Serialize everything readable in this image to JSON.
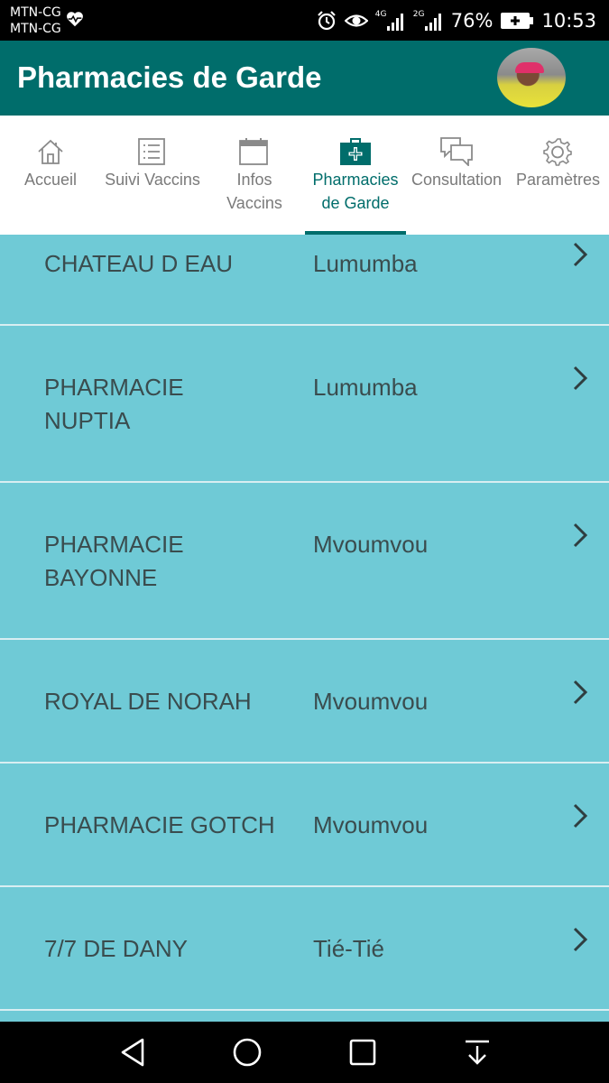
{
  "status_bar": {
    "carrier_1": "MTN-CG",
    "carrier_2": "MTN-CG",
    "network_1": "4G",
    "network_2": "2G",
    "battery": "76%",
    "time": "10:53"
  },
  "app_bar": {
    "title": "Pharmacies de Garde",
    "accent": "#006d6b"
  },
  "tabs": [
    {
      "label_1": "Accueil",
      "label_2": "",
      "icon": "home-icon"
    },
    {
      "label_1": "Suivi Vaccins",
      "label_2": "",
      "icon": "list-icon"
    },
    {
      "label_1": "Infos",
      "label_2": "Vaccins",
      "icon": "calendar-icon"
    },
    {
      "label_1": "Pharmacies",
      "label_2": "de Garde",
      "icon": "medical-bag-icon",
      "active": true
    },
    {
      "label_1": "Consultation",
      "label_2": "",
      "icon": "chat-icon"
    },
    {
      "label_1": "Paramètres",
      "label_2": "",
      "icon": "gear-icon"
    }
  ],
  "pharmacies": [
    {
      "name_1": "CHATEAU D EAU",
      "name_2": "",
      "area": "Lumumba"
    },
    {
      "name_1": "PHARMACIE",
      "name_2": "NUPTIA",
      "area": "Lumumba"
    },
    {
      "name_1": "PHARMACIE",
      "name_2": "BAYONNE",
      "area": "Mvoumvou"
    },
    {
      "name_1": "ROYAL DE NORAH",
      "name_2": "",
      "area": "Mvoumvou"
    },
    {
      "name_1": "PHARMACIE GOTCH",
      "name_2": "",
      "area": "Mvoumvou"
    },
    {
      "name_1": "7/7 DE DANY",
      "name_2": "",
      "area": "Tié-Tié"
    }
  ],
  "colors": {
    "list_background": "#6fcad6",
    "row_divider": "#d8eef2"
  }
}
